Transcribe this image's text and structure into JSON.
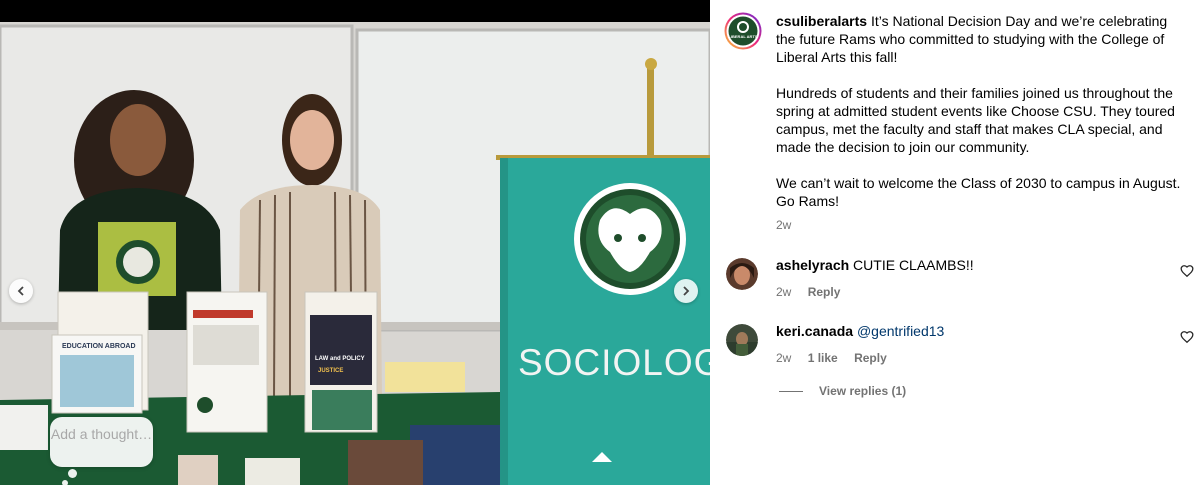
{
  "media": {
    "banner_text": "SOCIOLOGY",
    "add_thought_placeholder": "Add a thought…",
    "brochures": {
      "education_abroad": "EDUCATION ABROAD",
      "law_policy": "LAW and POLICY",
      "justice": "JUSTICE"
    }
  },
  "post": {
    "username": "csuliberalarts",
    "avatar_badge": "LIBERAL ARTS",
    "caption_p1": " It’s National Decision Day and we’re celebrating the future Rams who committed to studying with the College of Liberal Arts this fall!",
    "caption_p2": "Hundreds of students and their families joined us throughout the spring at admitted student events like Choose CSU. They toured campus, met the faculty and staff that makes CLA special, and made the decision to join our community.",
    "caption_p3": "We can’t wait to welcome the Class of 2030 to campus in August. Go Rams!",
    "age": "2w"
  },
  "comments": [
    {
      "username": "ashelyrach",
      "text": " CUTIE CLAAMBS!!",
      "age": "2w",
      "likes": "",
      "reply_label": "Reply"
    },
    {
      "username": "keri.canada",
      "mention": "@gentrified13",
      "age": "2w",
      "likes": "1 like",
      "reply_label": "Reply"
    }
  ],
  "view_replies": "View replies (1)",
  "colors": {
    "csu_green": "#1e4d2b",
    "banner_teal": "#2aa89a",
    "muted_text": "#737373",
    "mention": "#00376b"
  }
}
